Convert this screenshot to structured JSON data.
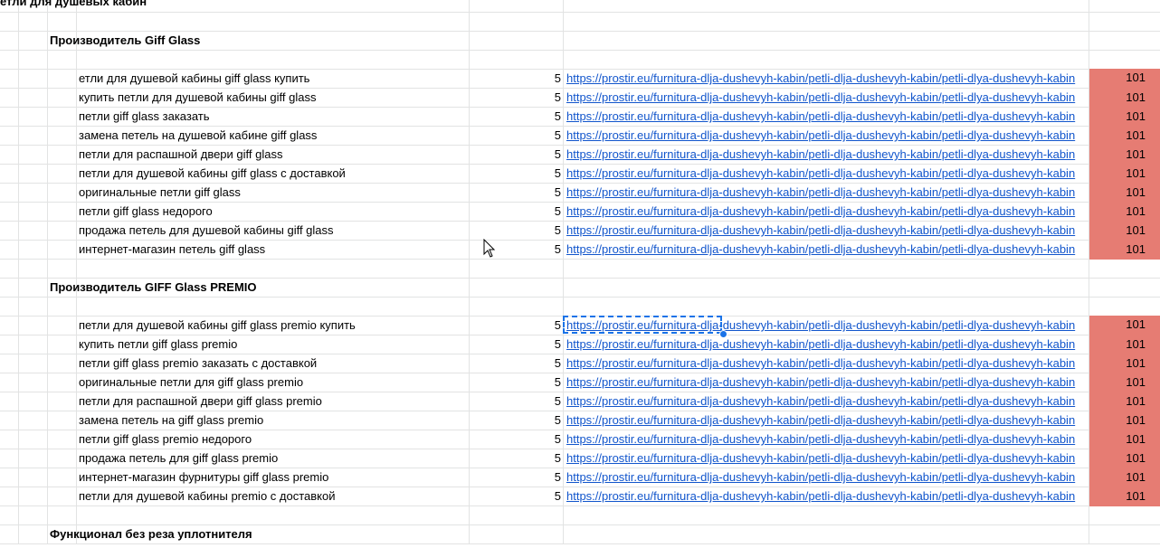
{
  "sheet": {
    "title": "етли для душевых кабин",
    "sections": [
      {
        "heading": "Производитель Giff Glass",
        "rows": [
          {
            "keyword": "етли для душевой кабины giff glass купить",
            "count": "5",
            "url": "https://prostir.eu/furnitura-dlja-dushevyh-kabin/petli-dlja-dushevyh-kabin/petli-dlya-dushevyh-kabin",
            "score": "101"
          },
          {
            "keyword": "купить петли для душевой кабины giff glass",
            "count": "5",
            "url": "https://prostir.eu/furnitura-dlja-dushevyh-kabin/petli-dlja-dushevyh-kabin/petli-dlya-dushevyh-kabin",
            "score": "101"
          },
          {
            "keyword": "петли giff glass заказать",
            "count": "5",
            "url": "https://prostir.eu/furnitura-dlja-dushevyh-kabin/petli-dlja-dushevyh-kabin/petli-dlya-dushevyh-kabin",
            "score": "101"
          },
          {
            "keyword": "замена петель на душевой кабине giff glass",
            "count": "5",
            "url": "https://prostir.eu/furnitura-dlja-dushevyh-kabin/petli-dlja-dushevyh-kabin/petli-dlya-dushevyh-kabin",
            "score": "101"
          },
          {
            "keyword": "петли для распашной двери giff glass",
            "count": "5",
            "url": "https://prostir.eu/furnitura-dlja-dushevyh-kabin/petli-dlja-dushevyh-kabin/petli-dlya-dushevyh-kabin",
            "score": "101"
          },
          {
            "keyword": "петли для душевой кабины giff glass с доставкой",
            "count": "5",
            "url": "https://prostir.eu/furnitura-dlja-dushevyh-kabin/petli-dlja-dushevyh-kabin/petli-dlya-dushevyh-kabin",
            "score": "101"
          },
          {
            "keyword": "оригинальные петли giff glass",
            "count": "5",
            "url": "https://prostir.eu/furnitura-dlja-dushevyh-kabin/petli-dlja-dushevyh-kabin/petli-dlya-dushevyh-kabin",
            "score": "101"
          },
          {
            "keyword": "петли giff glass недорого",
            "count": "5",
            "url": "https://prostir.eu/furnitura-dlja-dushevyh-kabin/petli-dlja-dushevyh-kabin/petli-dlya-dushevyh-kabin",
            "score": "101"
          },
          {
            "keyword": "продажа петель для душевой кабины giff glass",
            "count": "5",
            "url": "https://prostir.eu/furnitura-dlja-dushevyh-kabin/petli-dlja-dushevyh-kabin/petli-dlya-dushevyh-kabin",
            "score": "101"
          },
          {
            "keyword": "интернет-магазин петель giff glass",
            "count": "5",
            "url": "https://prostir.eu/furnitura-dlja-dushevyh-kabin/petli-dlja-dushevyh-kabin/petli-dlya-dushevyh-kabin",
            "score": "101"
          }
        ]
      },
      {
        "heading": "Производитель GIFF Glass PREMIO",
        "rows": [
          {
            "keyword": "петли для душевой кабины giff glass premio купить",
            "count": "5",
            "url": "https://prostir.eu/furnitura-dlja-dushevyh-kabin/petli-dlja-dushevyh-kabin/petli-dlya-dushevyh-kabin",
            "score": "101"
          },
          {
            "keyword": "купить петли giff glass premio",
            "count": "5",
            "url": "https://prostir.eu/furnitura-dlja-dushevyh-kabin/petli-dlja-dushevyh-kabin/petli-dlya-dushevyh-kabin",
            "score": "101"
          },
          {
            "keyword": "петли giff glass premio заказать с доставкой",
            "count": "5",
            "url": "https://prostir.eu/furnitura-dlja-dushevyh-kabin/petli-dlja-dushevyh-kabin/petli-dlya-dushevyh-kabin",
            "score": "101"
          },
          {
            "keyword": "оригинальные петли для giff glass premio",
            "count": "5",
            "url": "https://prostir.eu/furnitura-dlja-dushevyh-kabin/petli-dlja-dushevyh-kabin/petli-dlya-dushevyh-kabin",
            "score": "101"
          },
          {
            "keyword": "петли для распашной двери giff glass premio",
            "count": "5",
            "url": "https://prostir.eu/furnitura-dlja-dushevyh-kabin/petli-dlja-dushevyh-kabin/petli-dlya-dushevyh-kabin",
            "score": "101"
          },
          {
            "keyword": "замена петель на giff glass premio",
            "count": "5",
            "url": "https://prostir.eu/furnitura-dlja-dushevyh-kabin/petli-dlja-dushevyh-kabin/petli-dlya-dushevyh-kabin",
            "score": "101"
          },
          {
            "keyword": "петли giff glass premio недорого",
            "count": "5",
            "url": "https://prostir.eu/furnitura-dlja-dushevyh-kabin/petli-dlja-dushevyh-kabin/petli-dlya-dushevyh-kabin",
            "score": "101"
          },
          {
            "keyword": "продажа петель для giff glass premio",
            "count": "5",
            "url": "https://prostir.eu/furnitura-dlja-dushevyh-kabin/petli-dlja-dushevyh-kabin/petli-dlya-dushevyh-kabin",
            "score": "101"
          },
          {
            "keyword": "интернет-магазин фурнитуры giff glass premio",
            "count": "5",
            "url": "https://prostir.eu/furnitura-dlja-dushevyh-kabin/petli-dlja-dushevyh-kabin/petli-dlya-dushevyh-kabin",
            "score": "101"
          },
          {
            "keyword": "петли для душевой кабины premio с доставкой",
            "count": "5",
            "url": "https://prostir.eu/furnitura-dlja-dushevyh-kabin/petli-dlja-dushevyh-kabin/petli-dlya-dushevyh-kabin",
            "score": "101"
          }
        ]
      },
      {
        "heading": "Функционал без реза уплотнителя",
        "rows": []
      }
    ],
    "selected_cell": {
      "section": 1,
      "row": 0
    },
    "colors": {
      "score_fill": "#e67c73",
      "link": "#1155cc",
      "selection": "#1a73e8",
      "gridline": "#e2e3e3"
    }
  }
}
